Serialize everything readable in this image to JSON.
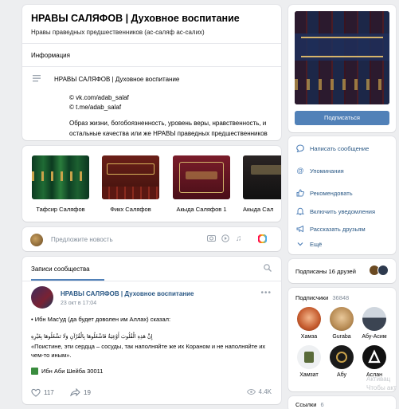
{
  "header": {
    "title": "НРАВЫ САЛЯФОВ | Духовное воспитание",
    "subtitle": "Нравы праведных предшественников (ас-саляф ас-салих)",
    "info_label": "Информация",
    "desc_title": "НРАВЫ САЛЯФОВ | Духовное воспитание",
    "link1": "© vk.com/adab_salaf",
    "link2": "© t.me/adab_salaf",
    "body": "Образ жизни, богобоязненность, уровень веры, нравственность, и остальные качества или же НРАВЫ праведных предшественников (ас-саляф ас-салих)."
  },
  "products": [
    {
      "label": "Тафсир Саляфов"
    },
    {
      "label": "Фикх Саляфов"
    },
    {
      "label": "Акыда Саляфов 1"
    },
    {
      "label": "Акыда Сал"
    }
  ],
  "postbox": {
    "placeholder": "Предложите новость"
  },
  "wall": {
    "tab": "Записи сообщества",
    "post": {
      "author": "НРАВЫ САЛЯФОВ | Духовное воспитание",
      "date": "23 окт в 17:04",
      "line1": "• Ибн Мас'уд (да будет доволен им Аллах) сказал:",
      "arabic": "إِنَّ هَذِهِ الْقُلُوبَ أَوْعِيَةٌ فَاشْغَلُوهَا بِالْقُرْآنِ وَلَا تَشْغَلُوهَا بِغَيْرِهِ",
      "quote": "«Поистине, эти сердца – сосуды, так наполняйте же их Кораном и не наполняйте их чем-то иным».",
      "source": "Ибн Аби Шейба 30011",
      "likes": "117",
      "shares": "19",
      "views": "4.4K"
    }
  },
  "sidebar": {
    "subscribe": "Подписаться",
    "menu": [
      {
        "label": "Написать сообщение"
      },
      {
        "label": "Упоминания"
      },
      {
        "label": "Рекомендовать"
      },
      {
        "label": "Включить уведомления"
      },
      {
        "label": "Рассказать друзьям"
      },
      {
        "label": "Ещё"
      }
    ],
    "friends": "Подписаны 16 друзей",
    "subscribers_label": "Подписчики",
    "subscribers_count": "36848",
    "subscribers": [
      {
        "name": "Хамза"
      },
      {
        "name": "Guraba"
      },
      {
        "name": "Абу-Асим"
      },
      {
        "name": "Хамзат"
      },
      {
        "name": "Абу"
      },
      {
        "name": "Аслан"
      }
    ],
    "links_label": "Ссылки",
    "links_count": "6"
  },
  "watermark": {
    "line1": "Активац",
    "line2": "Чтобы акт"
  },
  "colors": {
    "accent": "#5181b8",
    "link": "#2a5885",
    "background": "#edeef0"
  }
}
